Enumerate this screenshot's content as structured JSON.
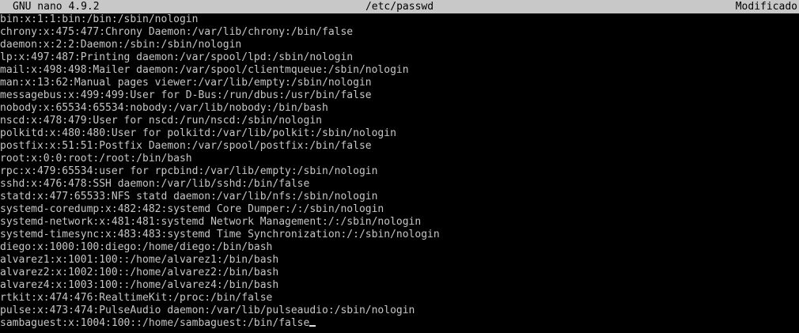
{
  "titlebar": {
    "app": "GNU nano 4.9.2",
    "filename": "/etc/passwd",
    "status": "Modificado"
  },
  "lines": [
    "bin:x:1:1:bin:/bin:/sbin/nologin",
    "chrony:x:475:477:Chrony Daemon:/var/lib/chrony:/bin/false",
    "daemon:x:2:2:Daemon:/sbin:/sbin/nologin",
    "lp:x:497:487:Printing daemon:/var/spool/lpd:/sbin/nologin",
    "mail:x:498:498:Mailer daemon:/var/spool/clientmqueue:/sbin/nologin",
    "man:x:13:62:Manual pages viewer:/var/lib/empty:/sbin/nologin",
    "messagebus:x:499:499:User for D-Bus:/run/dbus:/usr/bin/false",
    "nobody:x:65534:65534:nobody:/var/lib/nobody:/bin/bash",
    "nscd:x:478:479:User for nscd:/run/nscd:/sbin/nologin",
    "polkitd:x:480:480:User for polkitd:/var/lib/polkit:/sbin/nologin",
    "postfix:x:51:51:Postfix Daemon:/var/spool/postfix:/bin/false",
    "root:x:0:0:root:/root:/bin/bash",
    "rpc:x:479:65534:user for rpcbind:/var/lib/empty:/sbin/nologin",
    "sshd:x:476:478:SSH daemon:/var/lib/sshd:/bin/false",
    "statd:x:477:65533:NFS statd daemon:/var/lib/nfs:/sbin/nologin",
    "systemd-coredump:x:482:482:systemd Core Dumper:/:/sbin/nologin",
    "systemd-network:x:481:481:systemd Network Management:/:/sbin/nologin",
    "systemd-timesync:x:483:483:systemd Time Synchronization:/:/sbin/nologin",
    "diego:x:1000:100:diego:/home/diego:/bin/bash",
    "alvarez1:x:1001:100::/home/alvarez1:/bin/bash",
    "alvarez2:x:1002:100::/home/alvarez2:/bin/bash",
    "alvarez4:x:1003:100::/home/alvarez4:/bin/bash",
    "rtkit:x:474:476:RealtimeKit:/proc:/bin/false",
    "pulse:x:473:474:PulseAudio daemon:/var/lib/pulseaudio:/sbin/nologin",
    "sambaguest:x:1004:100::/home/sambaguest:/bin/false"
  ]
}
